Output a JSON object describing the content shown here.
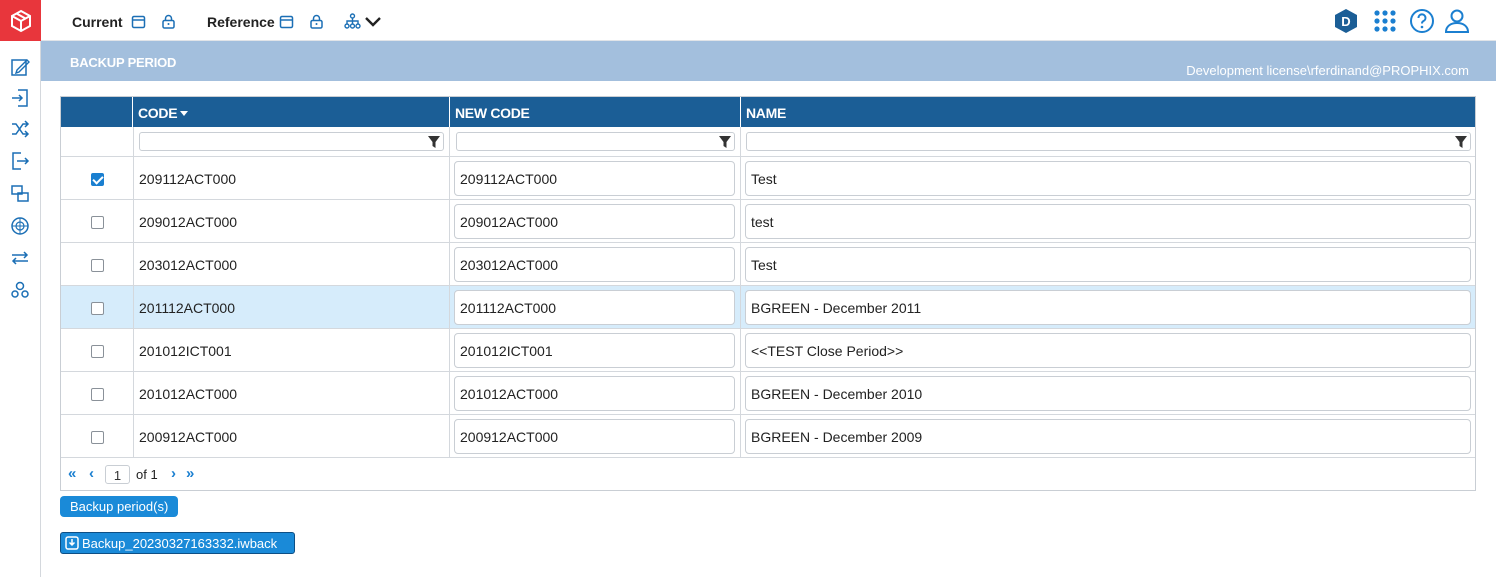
{
  "topbar": {
    "current_label": "Current",
    "reference_label": "Reference"
  },
  "band": {
    "title": "BACKUP PERIOD",
    "license": "Development license\\rferdinand@PROPHIX.com"
  },
  "grid": {
    "columns": {
      "code": "CODE",
      "new_code": "NEW CODE",
      "name": "NAME"
    },
    "rows": [
      {
        "checked": true,
        "code": "209112ACT000",
        "new_code": "209112ACT000",
        "name": "Test"
      },
      {
        "checked": false,
        "code": "209012ACT000",
        "new_code": "209012ACT000",
        "name": "test"
      },
      {
        "checked": false,
        "code": "203012ACT000",
        "new_code": "203012ACT000",
        "name": "Test"
      },
      {
        "checked": false,
        "code": "201112ACT000",
        "new_code": "201112ACT000",
        "name": "BGREEN - December 2011"
      },
      {
        "checked": false,
        "code": "201012ICT001",
        "new_code": "201012ICT001",
        "name": "<<TEST Close Period>>"
      },
      {
        "checked": false,
        "code": "201012ACT000",
        "new_code": "201012ACT000",
        "name": "BGREEN - December 2010"
      },
      {
        "checked": false,
        "code": "200912ACT000",
        "new_code": "200912ACT000",
        "name": "BGREEN - December 2009"
      }
    ],
    "pager": {
      "page": "1",
      "of_label": "of 1"
    }
  },
  "actions": {
    "backup_button": "Backup period(s)",
    "file_link": "Backup_20230327163332.iwback"
  },
  "colors": {
    "brand": "#e8363c",
    "header": "#1b5e96",
    "band": "#a3bfdd",
    "accent": "#1a8ad8",
    "selected_row": "#d6ecfb"
  }
}
